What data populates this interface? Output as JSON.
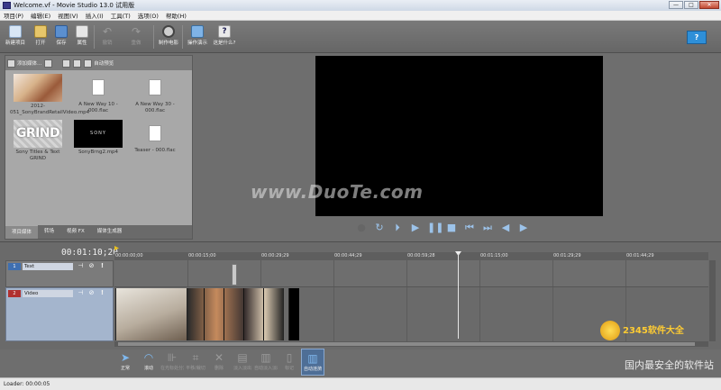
{
  "window": {
    "title": "Welcome.vf - Movie Studio 13.0 试用版",
    "controls": [
      "—",
      "□",
      "✕"
    ]
  },
  "menu": [
    "项目(P)",
    "编辑(E)",
    "视图(V)",
    "插入(I)",
    "工具(T)",
    "选项(O)",
    "帮助(H)"
  ],
  "toolbar": {
    "new": "新建项目",
    "open": "打开",
    "save": "保存",
    "properties": "属性",
    "undo": "撤销",
    "redo": "重做",
    "make_movie": "制作电影",
    "show_me": "操作演示",
    "whats_this": "这是什么?",
    "help": "?"
  },
  "media": {
    "import_label": "添加媒体...",
    "auto_preview": "自动预览",
    "items": [
      {
        "name": "2012-051_SonyBrandRetailVideo.mp4",
        "kind": "photo"
      },
      {
        "name": "A New Way 10 - 000.flac",
        "kind": "file"
      },
      {
        "name": "A New Way 30 - 000.flac",
        "kind": "file"
      },
      {
        "name": "Sony Titles & Text GRIND",
        "kind": "grind",
        "thumb_text": "GRIND"
      },
      {
        "name": "SonyBrng2.mp4",
        "kind": "sony",
        "thumb_text": "SONY"
      },
      {
        "name": "Teaser - 000.flac",
        "kind": "file"
      }
    ],
    "tabs": [
      "项目媒体",
      "转场",
      "视频 FX",
      "媒体生成器"
    ]
  },
  "preview": {
    "watermark": "www.DuoTe.com"
  },
  "timeline": {
    "timecode": "00:01:10;20",
    "ruler": [
      "00:00:00;00",
      "00:00:15;00",
      "00:00:29;29",
      "00:00:44;29",
      "00:00:59;28",
      "00:01:15;00",
      "00:01:29;29",
      "00:01:44;29"
    ],
    "tracks": {
      "text": {
        "num": "1",
        "name": "Text"
      },
      "video": {
        "num": "2",
        "name": "Video"
      }
    }
  },
  "edit_tools": [
    {
      "label": "正常",
      "active": true
    },
    {
      "label": "滚动",
      "active": true
    },
    {
      "label": "在光标处分割",
      "active": false
    },
    {
      "label": "平移/裁切",
      "active": false
    },
    {
      "label": "删除",
      "active": false
    },
    {
      "label": "淡入淡出",
      "active": false
    },
    {
      "label": "自动淡入淡出",
      "active": false
    },
    {
      "label": "标记",
      "active": false
    },
    {
      "label": "自动涟漪",
      "active": true,
      "on": true
    }
  ],
  "corner": {
    "logo": "2345软件大全",
    "tagline": "国内最安全的软件站"
  },
  "status": {
    "text": "Loader: 00:00:05"
  }
}
